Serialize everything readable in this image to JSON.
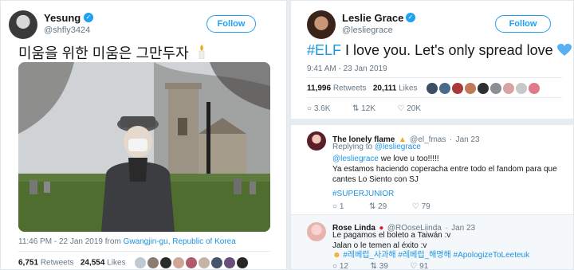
{
  "left": {
    "user": {
      "name": "Yesung",
      "handle": "@shfly3424"
    },
    "follow_label": "Follow",
    "tweet_text": "미움을 위한 미움은 그만두자",
    "timestamp": "11:46 PM - 22 Jan 2019 from",
    "location": "Gwangjin-gu, Republic of Korea",
    "retweets_count": "6,751",
    "retweets_label": "Retweets",
    "likes_count": "24,554",
    "likes_label": "Likes"
  },
  "right": {
    "user": {
      "name": "Leslie Grace",
      "handle": "@lesliegrace"
    },
    "follow_label": "Follow",
    "tweet_hashtag": "#ELF",
    "tweet_text": " I love you. Let's only spread love",
    "timestamp": "9:41 AM - 23 Jan 2019",
    "retweets_count": "11,996",
    "retweets_label": "Retweets",
    "likes_count": "20,111",
    "likes_label": "Likes",
    "actions": {
      "replies": "3.6K",
      "retweets": "12K",
      "likes": "20K"
    },
    "reply1": {
      "name": "The lonely flame",
      "handle": "@el_fmas",
      "date": "Jan 23",
      "replying_prefix": "Replying to",
      "replying_to": "@lesliegrace",
      "mention": "@lesliegrace",
      "line1": " we love u too!!!!!",
      "line2": "Ya estamos haciendo coperacha entre todo el fandom para que cantes Lo Siento con SJ",
      "hashtag": "#SUPERJUNIOR",
      "actions": {
        "replies": "1",
        "retweets": "29",
        "likes": "79"
      }
    },
    "reply2": {
      "name": "Rose Linda",
      "handle": "@ROoseLiinda",
      "date": "Jan 23",
      "line1": "Le pagamos el boleto a Taiwán :v",
      "line2": "Jalan o le temen al éxito :v",
      "hashtags": "#레베럽_사과해 #레베럽_해명해 #ApologizeToLeeteuk",
      "actions": {
        "replies": "12",
        "retweets": "39",
        "likes": "91"
      }
    }
  },
  "colors": {
    "accent": "#1da1f2",
    "link": "#1b95e0",
    "muted": "#657786",
    "like_heart": "#e0245e",
    "love_heart": "#5ab0f0"
  }
}
